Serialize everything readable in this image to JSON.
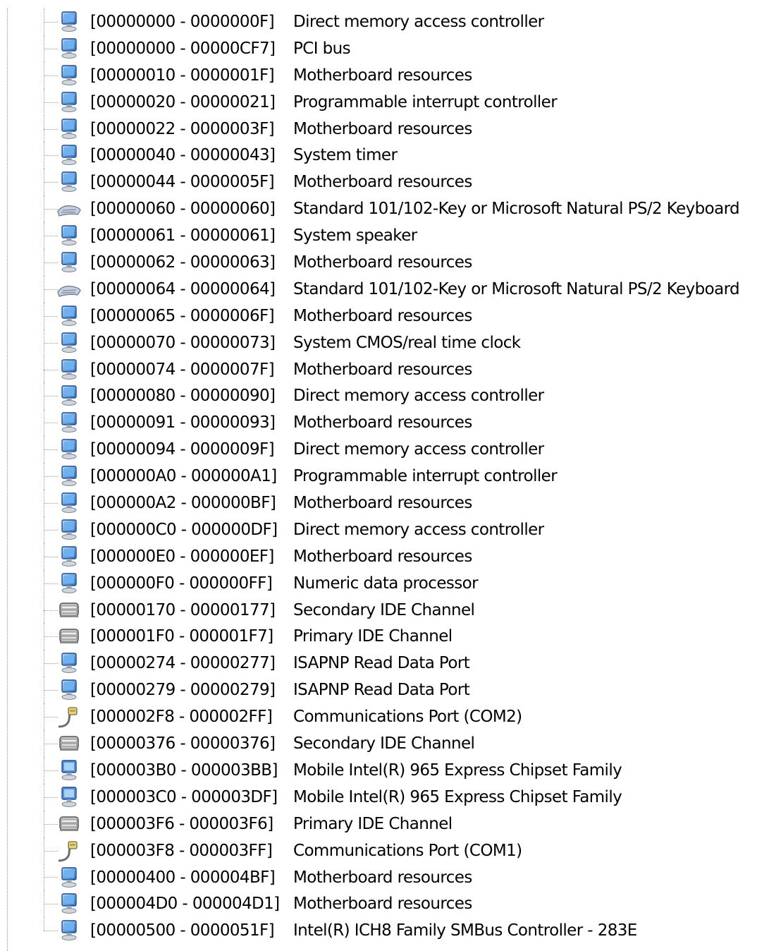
{
  "resources": [
    {
      "range": "[00000000 - 0000000F]",
      "device": "Direct memory access controller",
      "icon": "system-device-icon"
    },
    {
      "range": "[00000000 - 00000CF7]",
      "device": "PCI bus",
      "icon": "system-device-icon"
    },
    {
      "range": "[00000010 - 0000001F]",
      "device": "Motherboard resources",
      "icon": "system-device-icon"
    },
    {
      "range": "[00000020 - 00000021]",
      "device": "Programmable interrupt controller",
      "icon": "system-device-icon"
    },
    {
      "range": "[00000022 - 0000003F]",
      "device": "Motherboard resources",
      "icon": "system-device-icon"
    },
    {
      "range": "[00000040 - 00000043]",
      "device": "System timer",
      "icon": "system-device-icon"
    },
    {
      "range": "[00000044 - 0000005F]",
      "device": "Motherboard resources",
      "icon": "system-device-icon"
    },
    {
      "range": "[00000060 - 00000060]",
      "device": "Standard 101/102-Key or Microsoft Natural PS/2 Keyboard",
      "icon": "keyboard-icon"
    },
    {
      "range": "[00000061 - 00000061]",
      "device": "System speaker",
      "icon": "system-device-icon"
    },
    {
      "range": "[00000062 - 00000063]",
      "device": "Motherboard resources",
      "icon": "system-device-icon"
    },
    {
      "range": "[00000064 - 00000064]",
      "device": "Standard 101/102-Key or Microsoft Natural PS/2 Keyboard",
      "icon": "keyboard-icon"
    },
    {
      "range": "[00000065 - 0000006F]",
      "device": "Motherboard resources",
      "icon": "system-device-icon"
    },
    {
      "range": "[00000070 - 00000073]",
      "device": "System CMOS/real time clock",
      "icon": "system-device-icon"
    },
    {
      "range": "[00000074 - 0000007F]",
      "device": "Motherboard resources",
      "icon": "system-device-icon"
    },
    {
      "range": "[00000080 - 00000090]",
      "device": "Direct memory access controller",
      "icon": "system-device-icon"
    },
    {
      "range": "[00000091 - 00000093]",
      "device": "Motherboard resources",
      "icon": "system-device-icon"
    },
    {
      "range": "[00000094 - 0000009F]",
      "device": "Direct memory access controller",
      "icon": "system-device-icon"
    },
    {
      "range": "[000000A0 - 000000A1]",
      "device": "Programmable interrupt controller",
      "icon": "system-device-icon"
    },
    {
      "range": "[000000A2 - 000000BF]",
      "device": "Motherboard resources",
      "icon": "system-device-icon"
    },
    {
      "range": "[000000C0 - 000000DF]",
      "device": "Direct memory access controller",
      "icon": "system-device-icon"
    },
    {
      "range": "[000000E0 - 000000EF]",
      "device": "Motherboard resources",
      "icon": "system-device-icon"
    },
    {
      "range": "[000000F0 - 000000FF]",
      "device": "Numeric data processor",
      "icon": "system-device-icon"
    },
    {
      "range": "[00000170 - 00000177]",
      "device": "Secondary IDE Channel",
      "icon": "ide-channel-icon"
    },
    {
      "range": "[000001F0 - 000001F7]",
      "device": "Primary IDE Channel",
      "icon": "ide-channel-icon"
    },
    {
      "range": "[00000274 - 00000277]",
      "device": "ISAPNP Read Data Port",
      "icon": "system-device-icon"
    },
    {
      "range": "[00000279 - 00000279]",
      "device": "ISAPNP Read Data Port",
      "icon": "system-device-icon"
    },
    {
      "range": "[000002F8 - 000002FF]",
      "device": "Communications Port (COM2)",
      "icon": "port-icon"
    },
    {
      "range": "[00000376 - 00000376]",
      "device": "Secondary IDE Channel",
      "icon": "ide-channel-icon"
    },
    {
      "range": "[000003B0 - 000003BB]",
      "device": "Mobile Intel(R) 965 Express Chipset Family",
      "icon": "display-adapter-icon"
    },
    {
      "range": "[000003C0 - 000003DF]",
      "device": "Mobile Intel(R) 965 Express Chipset Family",
      "icon": "display-adapter-icon"
    },
    {
      "range": "[000003F6 - 000003F6]",
      "device": "Primary IDE Channel",
      "icon": "ide-channel-icon"
    },
    {
      "range": "[000003F8 - 000003FF]",
      "device": "Communications Port (COM1)",
      "icon": "port-icon"
    },
    {
      "range": "[00000400 - 000004BF]",
      "device": "Motherboard resources",
      "icon": "system-device-icon"
    },
    {
      "range": "[000004D0 - 000004D1]",
      "device": "Motherboard resources",
      "icon": "system-device-icon"
    },
    {
      "range": "[00000500 - 0000051F]",
      "device": "Intel(R) ICH8 Family SMBus Controller - 283E",
      "icon": "system-device-icon"
    }
  ]
}
